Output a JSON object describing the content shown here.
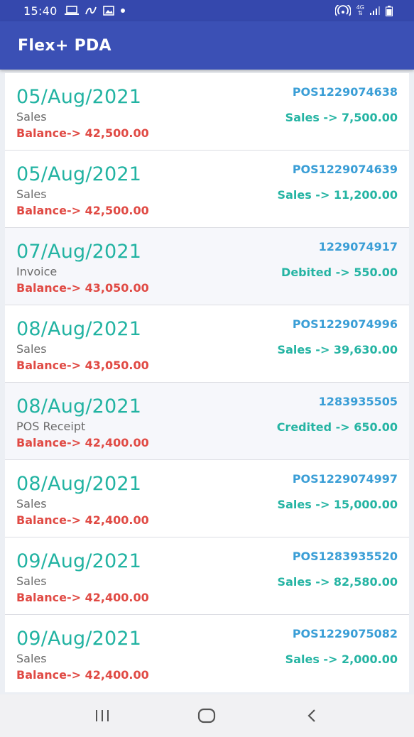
{
  "status_bar": {
    "time": "15:40",
    "icons_left": [
      "laptop-icon",
      "link-icon",
      "image-icon",
      "dot-icon"
    ],
    "icons_right": [
      "hotspot-icon",
      "data-4g-icon",
      "signal-icon",
      "battery-icon"
    ],
    "network_label": "4G"
  },
  "app_bar": {
    "title": "Flex+ PDA",
    "color": "#3b50b5"
  },
  "colors": {
    "date": "#22b3a2",
    "balance": "#e04a44",
    "reference": "#3a9ed6",
    "amount": "#25b4a3",
    "type": "#6b6b6b"
  },
  "transactions": [
    {
      "date": "05/Aug/2021",
      "type": "Sales",
      "balance": "Balance-> 42,500.00",
      "reference": "POS1229074638",
      "amount": "Sales -> 7,500.00"
    },
    {
      "date": "05/Aug/2021",
      "type": "Sales",
      "balance": "Balance-> 42,500.00",
      "reference": "POS1229074639",
      "amount": "Sales -> 11,200.00"
    },
    {
      "date": "07/Aug/2021",
      "type": "Invoice",
      "balance": "Balance-> 43,050.00",
      "reference": "1229074917",
      "amount": "Debited -> 550.00"
    },
    {
      "date": "08/Aug/2021",
      "type": "Sales",
      "balance": "Balance-> 43,050.00",
      "reference": "POS1229074996",
      "amount": "Sales -> 39,630.00"
    },
    {
      "date": "08/Aug/2021",
      "type": "POS Receipt",
      "balance": "Balance-> 42,400.00",
      "reference": "1283935505",
      "amount": "Credited -> 650.00"
    },
    {
      "date": "08/Aug/2021",
      "type": "Sales",
      "balance": "Balance-> 42,400.00",
      "reference": "POS1229074997",
      "amount": "Sales -> 15,000.00"
    },
    {
      "date": "09/Aug/2021",
      "type": "Sales",
      "balance": "Balance-> 42,400.00",
      "reference": "POS1283935520",
      "amount": "Sales -> 82,580.00"
    },
    {
      "date": "09/Aug/2021",
      "type": "Sales",
      "balance": "Balance-> 42,400.00",
      "reference": "POS1229075082",
      "amount": "Sales -> 2,000.00"
    }
  ],
  "nav_bar": {
    "buttons": [
      "recent-apps-icon",
      "home-icon",
      "back-icon"
    ]
  }
}
